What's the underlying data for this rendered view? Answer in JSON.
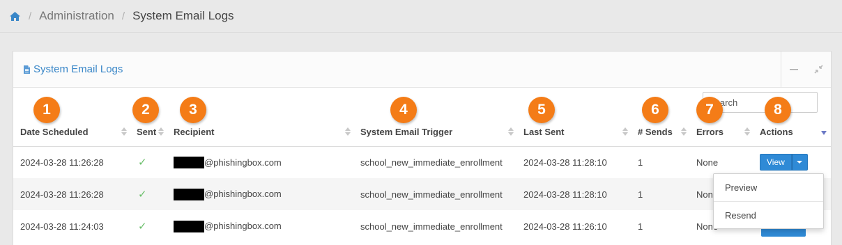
{
  "breadcrumb": {
    "home_icon": "home-icon",
    "items": [
      "Administration",
      "System Email Logs"
    ]
  },
  "panel": {
    "title": "System Email Logs",
    "title_icon": "document-icon",
    "minimize_icon": "minimize-icon",
    "fullscreen_icon": "compress-icon"
  },
  "search": {
    "placeholder": "Search",
    "value": ""
  },
  "table": {
    "columns": [
      "Date Scheduled",
      "Sent",
      "Recipient",
      "System Email Trigger",
      "Last Sent",
      "# Sends",
      "Errors",
      "Actions"
    ],
    "rows": [
      {
        "date_scheduled": "2024-03-28 11:26:28",
        "sent": "✓",
        "recipient": "@phishingbox.com",
        "trigger": "school_new_immediate_enrollment",
        "last_sent": "2024-03-28 11:28:10",
        "sends": "1",
        "errors": "None",
        "action_label": "View"
      },
      {
        "date_scheduled": "2024-03-28 11:26:28",
        "sent": "✓",
        "recipient": "@phishingbox.com",
        "trigger": "school_new_immediate_enrollment",
        "last_sent": "2024-03-28 11:28:10",
        "sends": "1",
        "errors": "None",
        "action_label": "View"
      },
      {
        "date_scheduled": "2024-03-28 11:24:03",
        "sent": "✓",
        "recipient": "@phishingbox.com",
        "trigger": "school_new_immediate_enrollment",
        "last_sent": "2024-03-28 11:26:10",
        "sends": "1",
        "errors": "None",
        "action_label": "View"
      }
    ]
  },
  "dropdown": {
    "items": [
      "Preview",
      "Resend"
    ]
  },
  "badges": [
    "1",
    "2",
    "3",
    "4",
    "5",
    "6",
    "7",
    "8"
  ],
  "colors": {
    "accent": "#2f8ad6",
    "badge": "#f47c17",
    "link": "#3a87c8",
    "check": "#6bbf6b"
  }
}
